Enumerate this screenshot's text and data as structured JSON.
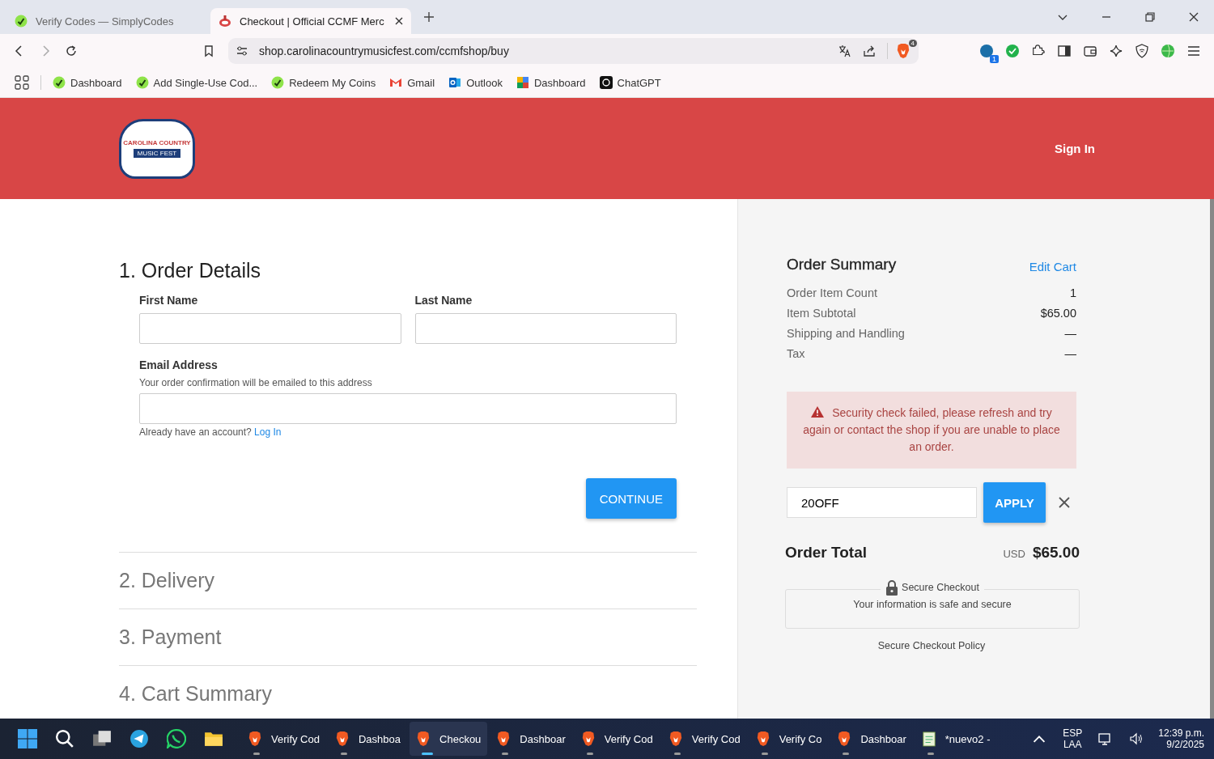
{
  "browser": {
    "tabs": [
      {
        "title": "Verify Codes — SimplyCodes",
        "kind": "simplycodes",
        "selected": false
      },
      {
        "title": "Checkout | Official CCMF Merc",
        "kind": "ccmf",
        "selected": true
      }
    ],
    "address": "shop.carolinacountrymusicfest.com/ccmfshop/buy",
    "shield_count": "4",
    "extension_badge": "1",
    "bookmarks": [
      {
        "label": "Dashboard",
        "kind": "simplycodes"
      },
      {
        "label": "Add Single-Use Cod...",
        "kind": "simplycodes"
      },
      {
        "label": "Redeem My Coins",
        "kind": "simplycodes"
      },
      {
        "label": "Gmail",
        "kind": "gmail"
      },
      {
        "label": "Outlook",
        "kind": "outlook"
      },
      {
        "label": "Dashboard",
        "kind": "puzzle"
      },
      {
        "label": "ChatGPT",
        "kind": "chatgpt"
      }
    ]
  },
  "header": {
    "logo_lines": [
      "CAROLINA COUNTRY",
      "MUSIC FEST"
    ],
    "sign_in": "Sign In"
  },
  "checkout": {
    "steps": [
      {
        "number": "1.",
        "title": "Order Details",
        "expanded": true
      },
      {
        "number": "2.",
        "title": "Delivery",
        "expanded": false
      },
      {
        "number": "3.",
        "title": "Payment",
        "expanded": false
      },
      {
        "number": "4.",
        "title": "Cart Summary",
        "expanded": false
      }
    ],
    "first_name": {
      "label": "First Name"
    },
    "last_name": {
      "label": "Last Name"
    },
    "email": {
      "label": "Email Address",
      "hint": "Your order confirmation will be emailed to this address"
    },
    "account_prompt": "Already have an account?",
    "login_link": "Log In",
    "continue": "CONTINUE"
  },
  "summary": {
    "title": "Order Summary",
    "edit_cart": "Edit Cart",
    "rows": [
      {
        "label": "Order Item Count",
        "value": "1"
      },
      {
        "label": "Item Subtotal",
        "value": "$65.00"
      },
      {
        "label": "Shipping and Handling",
        "value": "—"
      },
      {
        "label": "Tax",
        "value": "—"
      }
    ],
    "error": "Security check failed, please refresh and try again or contact the shop if you are unable to place an order.",
    "coupon": "20OFF",
    "apply": "APPLY",
    "total_label": "Order Total",
    "currency": "USD",
    "total": "$65.00",
    "secure_title": "Secure Checkout",
    "secure_text": "Your information is safe and secure",
    "policy": "Secure Checkout Policy"
  },
  "taskbar": {
    "windows": [
      {
        "label": "Verify Cod",
        "selected": false
      },
      {
        "label": "Dashboa",
        "selected": false
      },
      {
        "label": "Checkou",
        "selected": true
      },
      {
        "label": "Dashboar",
        "selected": false
      },
      {
        "label": "Verify Cod",
        "selected": false
      },
      {
        "label": "Verify Cod",
        "selected": false
      },
      {
        "label": "Verify Co",
        "selected": false
      },
      {
        "label": "Dashboar",
        "selected": false
      }
    ],
    "notepad": "*nuevo2 -",
    "lang": [
      "ESP",
      "LAA"
    ],
    "time": "12:39 p.m.",
    "date": "9/2/2025"
  }
}
